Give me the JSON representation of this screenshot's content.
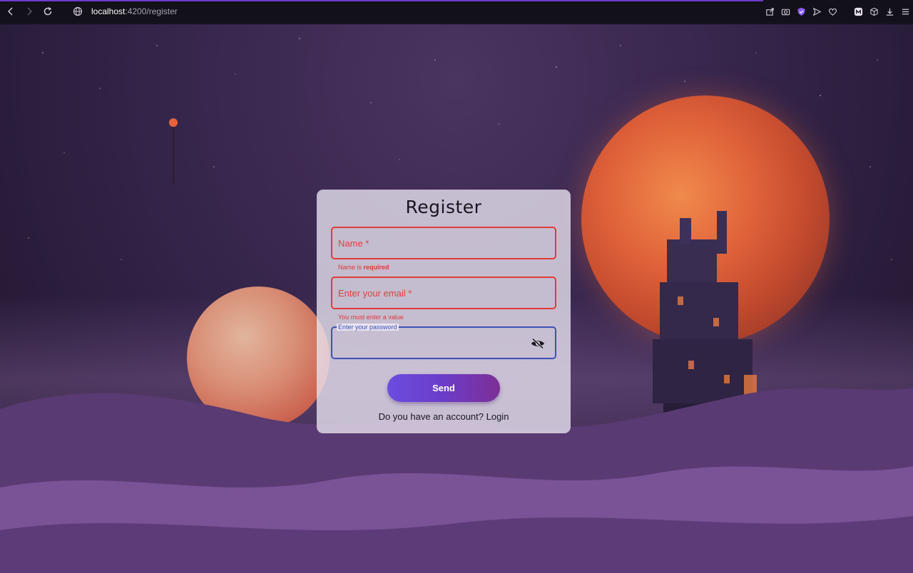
{
  "browser": {
    "url_host": "localhost",
    "url_path": ":4200/register",
    "icons": [
      "back-icon",
      "forward-icon",
      "reload-icon",
      "globe-icon",
      "share-icon",
      "camera-icon",
      "shield-icon",
      "send-icon",
      "heart-icon",
      "extension-icon",
      "cube-icon",
      "download-icon",
      "menu-icon"
    ],
    "accent": "#6c3bd1"
  },
  "form": {
    "title": "Register",
    "name_placeholder": "Name *",
    "name_error_prefix": "Name is ",
    "name_error_strong": "required",
    "email_placeholder": "Enter your email *",
    "email_error": "You must enter a value",
    "password_label": "Enter your password",
    "send_label": "Send",
    "login_prompt": "Do you have an account? Login"
  },
  "colors": {
    "error": "#e23b38",
    "focus": "#3f51b5",
    "button_start": "#6a4de0",
    "button_end": "#7d2f95"
  }
}
